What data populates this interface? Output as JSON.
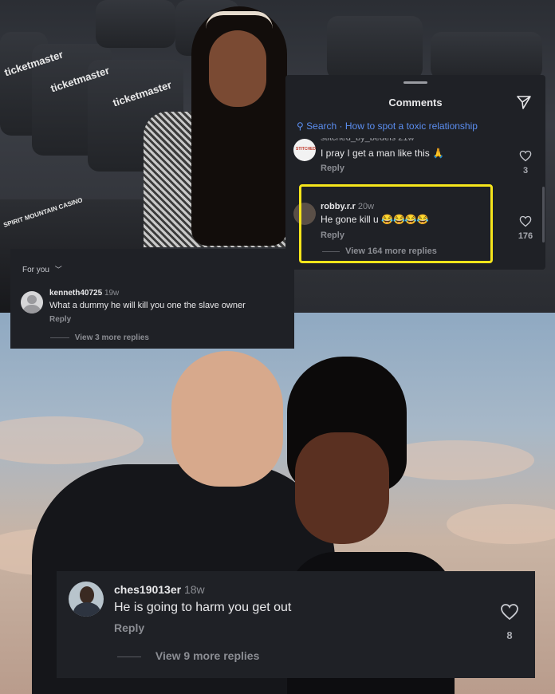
{
  "top_photo": {
    "seat_brand": "ticketmaster",
    "seat_brand_2": "SPIRIT MOUNTAIN CASINO"
  },
  "comments_sheet": {
    "title": "Comments",
    "search_prefix": "Search",
    "search_query": "How to spot a toxic relationship",
    "cut_username": "stitched_by_bedels 21w",
    "comment1": {
      "avatar_text": "STITCHED",
      "text": "I pray I get a man like this 🙏",
      "reply_label": "Reply",
      "likes": "3"
    },
    "comment2": {
      "username": "robby.r.r",
      "time": "20w",
      "text": "He gone kill u 😂😂😂😂",
      "reply_label": "Reply",
      "likes": "176",
      "view_more": "View 164 more replies"
    }
  },
  "comment_panel_b": {
    "filter_label": "For you",
    "username": "kenneth40725",
    "time": "19w",
    "text": "What a dummy he will kill you one the slave owner",
    "reply_label": "Reply",
    "view_more": "View 3 more replies"
  },
  "comment_panel_c": {
    "username": "ches19013er",
    "time": "18w",
    "text": "He is going to harm  you get out",
    "reply_label": "Reply",
    "likes": "8",
    "view_more": "View 9 more replies"
  },
  "colors": {
    "panel_bg": "#1f2126",
    "highlight": "#f5e51b",
    "search_link": "#5b8ef0"
  }
}
